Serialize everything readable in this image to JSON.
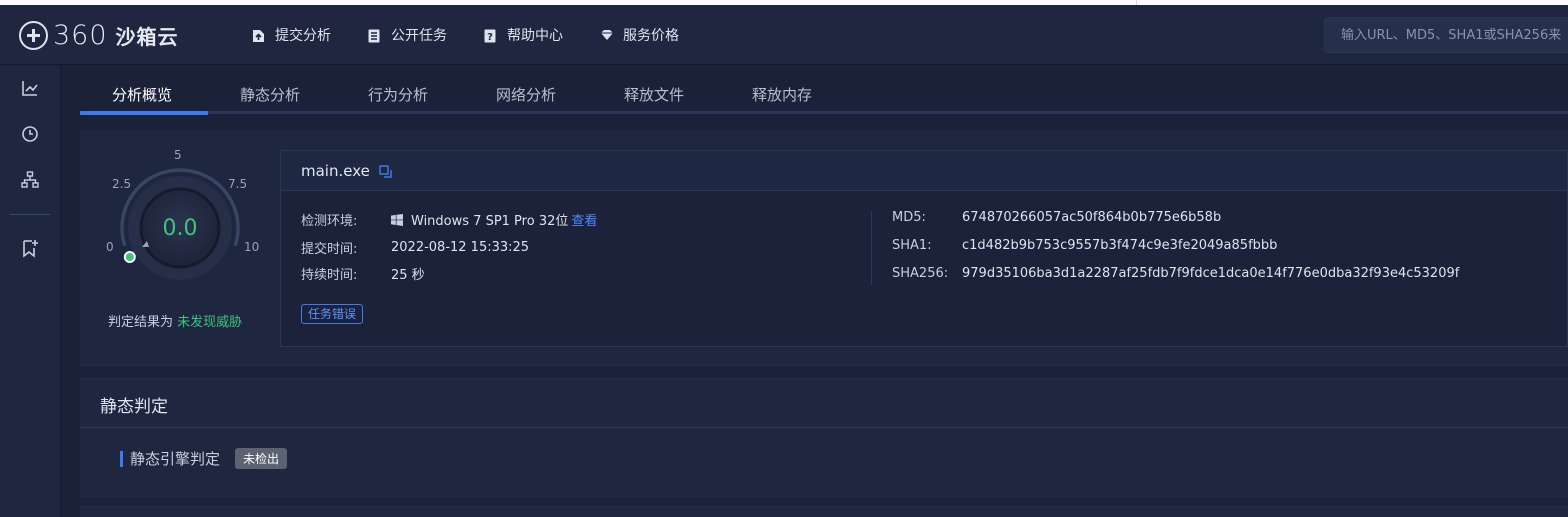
{
  "brand": {
    "logo_number": "360",
    "logo_text": "沙箱云"
  },
  "header": {
    "nav": [
      {
        "label": "提交分析",
        "icon": "upload-doc-icon"
      },
      {
        "label": "公开任务",
        "icon": "list-doc-icon"
      },
      {
        "label": "帮助中心",
        "icon": "help-doc-icon"
      },
      {
        "label": "服务价格",
        "icon": "diamond-icon"
      }
    ],
    "search_placeholder": "输入URL、MD5、SHA1或SHA256来"
  },
  "sidebar": {
    "icons": [
      "trend-chart-icon",
      "clock-icon",
      "network-icon",
      "bookmark-add-icon"
    ]
  },
  "tabs": [
    {
      "label": "分析概览",
      "active": true
    },
    {
      "label": "静态分析",
      "active": false
    },
    {
      "label": "行为分析",
      "active": false
    },
    {
      "label": "网络分析",
      "active": false
    },
    {
      "label": "释放文件",
      "active": false
    },
    {
      "label": "释放内存",
      "active": false
    }
  ],
  "gauge": {
    "score": "0.0",
    "score_value": 0.0,
    "scale_min": 0,
    "scale_max": 10,
    "ticks": [
      "0",
      "2.5",
      "5",
      "7.5",
      "10"
    ],
    "verdict_prefix": "判定结果为",
    "verdict_value": "未发现威胁",
    "verdict_color": "#3ec47b"
  },
  "file": {
    "name": "main.exe",
    "environment_label": "检测环境:",
    "environment_value": "Windows 7 SP1 Pro 32位",
    "environment_link": "查看",
    "submit_time_label": "提交时间:",
    "submit_time_value": "2022-08-12 15:33:25",
    "duration_label": "持续时间:",
    "duration_value": "25 秒",
    "md5_label": "MD5:",
    "md5_value": "674870266057ac50f864b0b775e6b58b",
    "sha1_label": "SHA1:",
    "sha1_value": "c1d482b9b753c9557b3f474c9e3fe2049a85fbbb",
    "sha256_label": "SHA256:",
    "sha256_value": "979d35106ba3d1a2287af25fdb7f9fdce1dca0e14f776e0dba32f93e4c53209f",
    "status_badge": "任务错误"
  },
  "static_verdict": {
    "title": "静态判定",
    "engine_label": "静态引擎判定",
    "engine_result": "未检出"
  },
  "colors": {
    "accent": "#3d7bf0",
    "background": "#1a2138",
    "panel": "#1e2640",
    "safe": "#3ec47b"
  }
}
